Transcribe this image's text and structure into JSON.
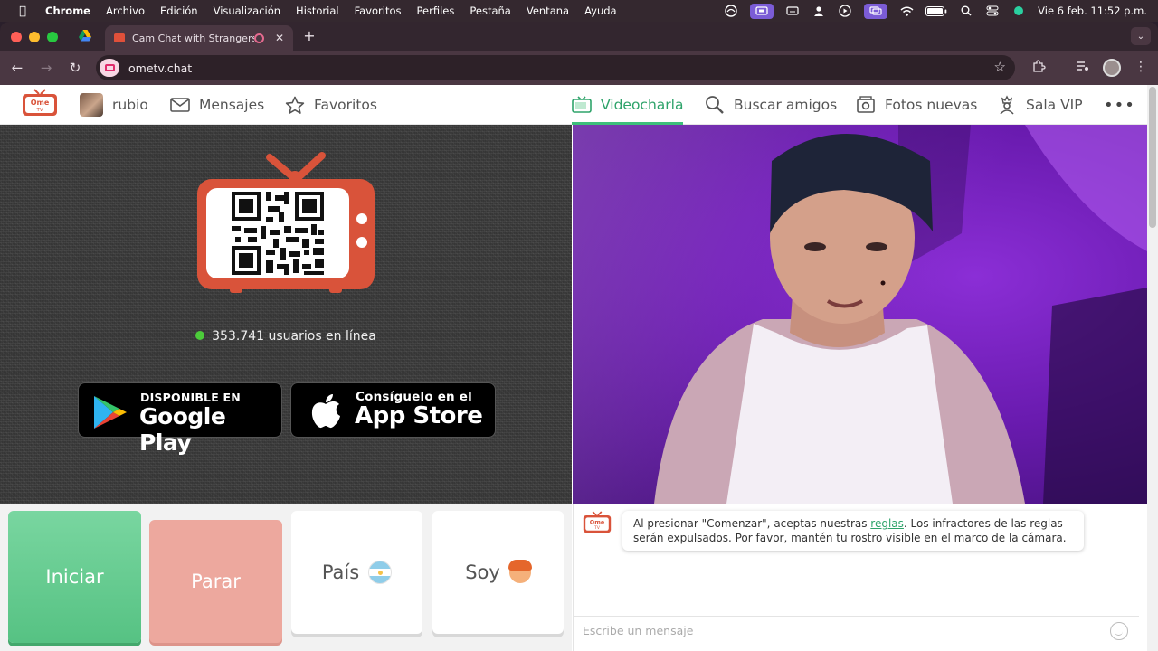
{
  "menubar": {
    "app": "Chrome",
    "items": [
      "Archivo",
      "Edición",
      "Visualización",
      "Historial",
      "Favoritos",
      "Perfiles",
      "Pestaña",
      "Ventana",
      "Ayuda"
    ],
    "datetime": "Vie 6 feb.  11:52 p.m."
  },
  "browser": {
    "tab_title": "Cam Chat with Strangers",
    "url": "ometv.chat"
  },
  "sitenav": {
    "logo_text_top": "Ome",
    "logo_text_bottom": "TV",
    "user": "rubio",
    "messages": "Mensajes",
    "favorites": "Favoritos",
    "videochat": "Videocharla",
    "find_friends": "Buscar amigos",
    "new_photos": "Fotos nuevas",
    "vip": "Sala VIP",
    "more": "•••"
  },
  "left": {
    "online_count": "353.741 usuarios en línea",
    "google_play_small": "DISPONIBLE EN",
    "google_play_big": "Google Play",
    "app_store_small": "Consíguelo en el",
    "app_store_big": "App Store"
  },
  "controls": {
    "start": "Iniciar",
    "stop": "Parar",
    "country": "País",
    "gender": "Soy"
  },
  "chat": {
    "msg_before": "Al presionar \"Comenzar\", aceptas nuestras ",
    "rules_link": "reglas",
    "msg_after": ". Los infractores de las reglas serán expulsados. Por favor, mantén tu rostro visible en el marco de la cámara.",
    "placeholder": "Escribe un mensaje"
  },
  "colors": {
    "accent_green": "#3dbf7a",
    "logo_red": "#d9533a",
    "start_green": "#5cc687",
    "stop_pink": "#eda89e",
    "video_purple": "#7a22c4"
  }
}
